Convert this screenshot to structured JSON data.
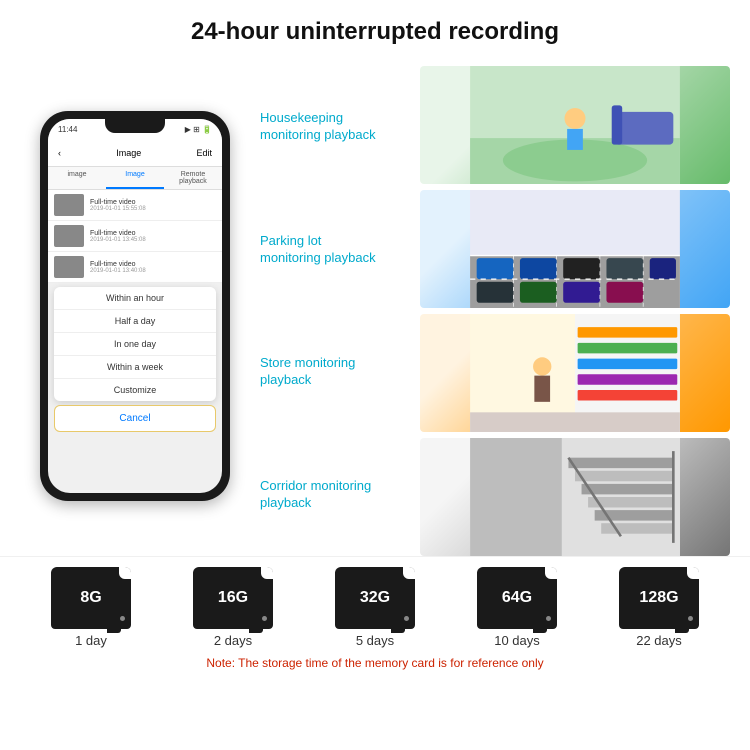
{
  "header": {
    "title": "24-hour uninterrupted recording"
  },
  "phone": {
    "status_time": "11:44",
    "nav_title": "Image",
    "nav_edit": "Edit",
    "tab_image": "image",
    "tab_image2": "Image",
    "tab_remote": "Remote playback",
    "list_items": [
      {
        "title": "Full-time video",
        "date": "2019-01-01 15:55:08"
      },
      {
        "title": "Full-time video",
        "date": "2019-01-01 13:45:08"
      },
      {
        "title": "Full-time video",
        "date": "2019-01-01 13:40:08"
      }
    ],
    "dropdown_items": [
      "Within an hour",
      "Half a day",
      "In one day",
      "Within a week",
      "Customize"
    ],
    "cancel_label": "Cancel"
  },
  "monitoring_labels": [
    "Housekeeping\nmonitoring playback",
    "Parking lot\nmonitoring playback",
    "Store monitoring\nplayback",
    "Corridor monitoring\nplayback"
  ],
  "storage_cards": [
    {
      "size": "8G",
      "days": "1 day"
    },
    {
      "size": "16G",
      "days": "2 days"
    },
    {
      "size": "32G",
      "days": "5 days"
    },
    {
      "size": "64G",
      "days": "10 days"
    },
    {
      "size": "128G",
      "days": "22 days"
    }
  ],
  "note": "Note: The storage time of the memory card is for reference only"
}
